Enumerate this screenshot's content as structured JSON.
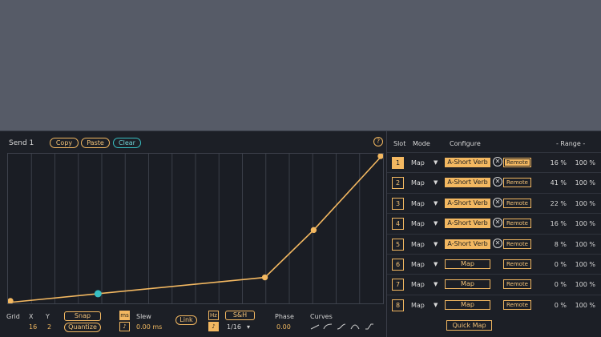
{
  "device": {
    "title": "Send 1",
    "copy_label": "Copy",
    "paste_label": "Paste",
    "clear_label": "Clear",
    "help_label": "?"
  },
  "colors": {
    "accent": "#f3b861",
    "clear": "#38bfc3",
    "background": "#1c1f26",
    "host_bg": "#565b67"
  },
  "chart_data": {
    "type": "line",
    "x": [
      0,
      0.24,
      0.685,
      0.815,
      1.0
    ],
    "y": [
      0,
      0.06,
      0.17,
      0.49,
      1.0
    ],
    "grid_columns": 16,
    "xlim": [
      0,
      1
    ],
    "ylim": [
      0,
      1
    ],
    "highlight_index": 1,
    "title": "",
    "xlabel": "",
    "ylabel": ""
  },
  "controls": {
    "grid_label": "Grid",
    "x_label": "X",
    "x_value": "16",
    "y_label": "Y",
    "y_value": "2",
    "snap_label": "Snap",
    "quantize_label": "Quantize",
    "ms_label": "ms",
    "slew_note_label": "♪",
    "slew_label": "Slew",
    "slew_value": "0.00 ms",
    "link_label": "Link",
    "hz_label": "Hz",
    "rate_note_label": "♪",
    "sh_label": "S&H",
    "rate_value": "1/16",
    "rate_arrow": "▾",
    "phase_label": "Phase",
    "phase_value": "0.00",
    "curves_label": "Curves"
  },
  "mapping": {
    "headers": {
      "slot": "Slot",
      "mode": "Mode",
      "configure": "Configure",
      "range": "- Range -"
    },
    "arrow": "▼",
    "x_icon": "✕",
    "quick_map_label": "Quick Map",
    "rows": [
      {
        "slot": "1",
        "active": true,
        "mode": "Map",
        "target": "A-Short Verb",
        "mapped": true,
        "remote": "Remote",
        "remote_on": true,
        "min": "16 %",
        "max": "100 %"
      },
      {
        "slot": "2",
        "active": false,
        "mode": "Map",
        "target": "A-Short Verb",
        "mapped": true,
        "remote": "Remote",
        "remote_on": false,
        "min": "41 %",
        "max": "100 %"
      },
      {
        "slot": "3",
        "active": false,
        "mode": "Map",
        "target": "A-Short Verb",
        "mapped": true,
        "remote": "Remote",
        "remote_on": false,
        "min": "22 %",
        "max": "100 %"
      },
      {
        "slot": "4",
        "active": false,
        "mode": "Map",
        "target": "A-Short Verb",
        "mapped": true,
        "remote": "Remote",
        "remote_on": false,
        "min": "16 %",
        "max": "100 %"
      },
      {
        "slot": "5",
        "active": false,
        "mode": "Map",
        "target": "A-Short Verb",
        "mapped": true,
        "remote": "Remote",
        "remote_on": false,
        "min": "8 %",
        "max": "100 %"
      },
      {
        "slot": "6",
        "active": false,
        "mode": "Map",
        "target": "Map",
        "mapped": false,
        "remote": "Remote",
        "remote_on": false,
        "min": "0 %",
        "max": "100 %"
      },
      {
        "slot": "7",
        "active": false,
        "mode": "Map",
        "target": "Map",
        "mapped": false,
        "remote": "Remote",
        "remote_on": false,
        "min": "0 %",
        "max": "100 %"
      },
      {
        "slot": "8",
        "active": false,
        "mode": "Map",
        "target": "Map",
        "mapped": false,
        "remote": "Remote",
        "remote_on": false,
        "min": "0 %",
        "max": "100 %"
      }
    ]
  }
}
